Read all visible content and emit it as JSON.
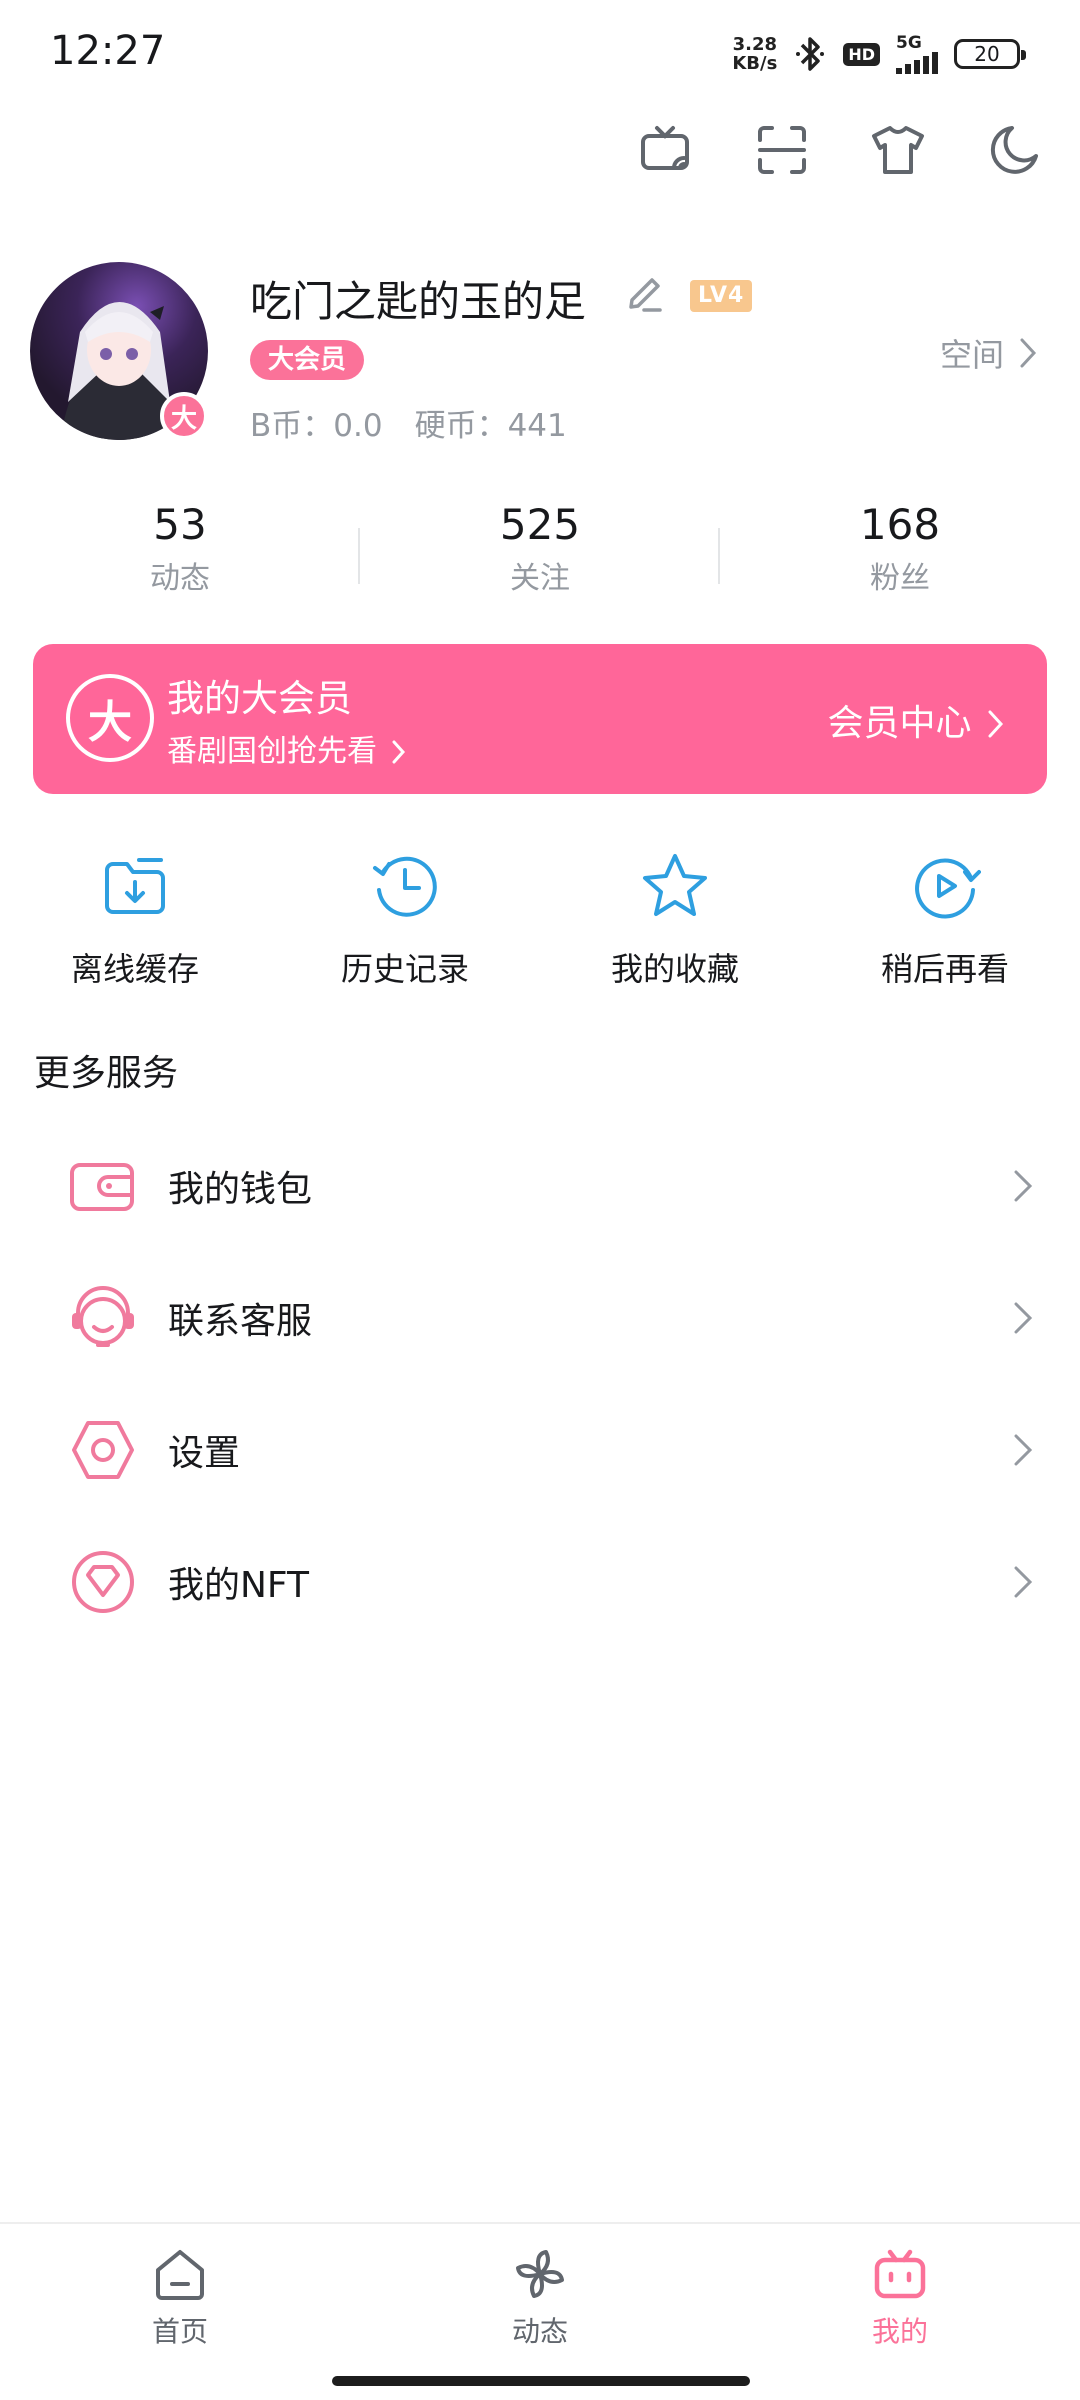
{
  "status_bar": {
    "time": "12:27",
    "net_speed_value": "3.28",
    "net_speed_unit": "KB/s",
    "hd": "HD",
    "network": "5G",
    "battery": "20"
  },
  "top_icons": [
    "tv-cast-icon",
    "scan-icon",
    "tshirt-icon",
    "moon-icon"
  ],
  "profile": {
    "username": "吃门之匙的玉的足",
    "level": "LV4",
    "vip_tag": "大会员",
    "avatar_badge": "大",
    "bcoin": "B币：0.0",
    "hardcoin": "硬币：441",
    "space_link": "空间"
  },
  "stats": [
    {
      "num": "53",
      "label": "动态"
    },
    {
      "num": "525",
      "label": "关注"
    },
    {
      "num": "168",
      "label": "粉丝"
    }
  ],
  "vip_banner": {
    "icon": "大",
    "title": "我的大会员",
    "subtitle": "番剧国创抢先看",
    "center": "会员中心"
  },
  "quick_actions": [
    {
      "icon": "offline-cache-icon",
      "label": "离线缓存"
    },
    {
      "icon": "history-icon",
      "label": "历史记录"
    },
    {
      "icon": "star-icon",
      "label": "我的收藏"
    },
    {
      "icon": "watch-later-icon",
      "label": "稍后再看"
    }
  ],
  "more_services": {
    "title": "更多服务",
    "items": [
      {
        "icon": "wallet-icon",
        "label": "我的钱包"
      },
      {
        "icon": "customer-service-icon",
        "label": "联系客服"
      },
      {
        "icon": "settings-icon",
        "label": "设置"
      },
      {
        "icon": "nft-icon",
        "label": "我的NFT"
      }
    ]
  },
  "bottom_nav": [
    {
      "icon": "home-icon",
      "label": "首页"
    },
    {
      "icon": "dynamic-icon",
      "label": "动态"
    },
    {
      "icon": "my-tv-icon",
      "label": "我的"
    }
  ],
  "colors": {
    "brand_pink": "#fb7299",
    "banner_pink": "#ff6699",
    "accent_blue": "#2e9fe0",
    "gray_text": "#9499a0"
  }
}
